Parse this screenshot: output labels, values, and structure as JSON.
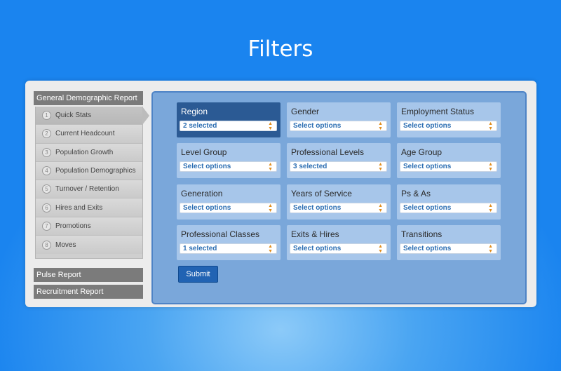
{
  "page": {
    "title": "Filters"
  },
  "sidebar": {
    "main_report": "General Demographic Report",
    "items": [
      {
        "num": "1",
        "label": "Quick Stats",
        "active": true
      },
      {
        "num": "2",
        "label": "Current Headcount"
      },
      {
        "num": "3",
        "label": "Population Growth"
      },
      {
        "num": "4",
        "label": "Population Demographics"
      },
      {
        "num": "5",
        "label": "Turnover / Retention"
      },
      {
        "num": "6",
        "label": "Hires and Exits"
      },
      {
        "num": "7",
        "label": "Promotions"
      },
      {
        "num": "8",
        "label": "Moves"
      }
    ],
    "pulse_report": "Pulse Report",
    "recruitment_report": "Recruitment Report"
  },
  "filters": [
    {
      "label": "Region",
      "value": "2 selected"
    },
    {
      "label": "Gender",
      "value": "Select options"
    },
    {
      "label": "Employment Status",
      "value": "Select options"
    },
    {
      "label": "Level Group",
      "value": "Select options"
    },
    {
      "label": "Professional Levels",
      "value": "3 selected"
    },
    {
      "label": "Age Group",
      "value": "Select options"
    },
    {
      "label": "Generation",
      "value": "Select options"
    },
    {
      "label": "Years of Service",
      "value": "Select options"
    },
    {
      "label": "Ps & As",
      "value": "Select options"
    },
    {
      "label": "Professional Classes",
      "value": "1 selected"
    },
    {
      "label": "Exits & Hires",
      "value": "Select options"
    },
    {
      "label": "Transitions",
      "value": "Select options"
    }
  ],
  "submit_label": "Submit",
  "colors": {
    "accent": "#2b5a94",
    "button": "#2163b3",
    "background": "#1a84ef"
  }
}
